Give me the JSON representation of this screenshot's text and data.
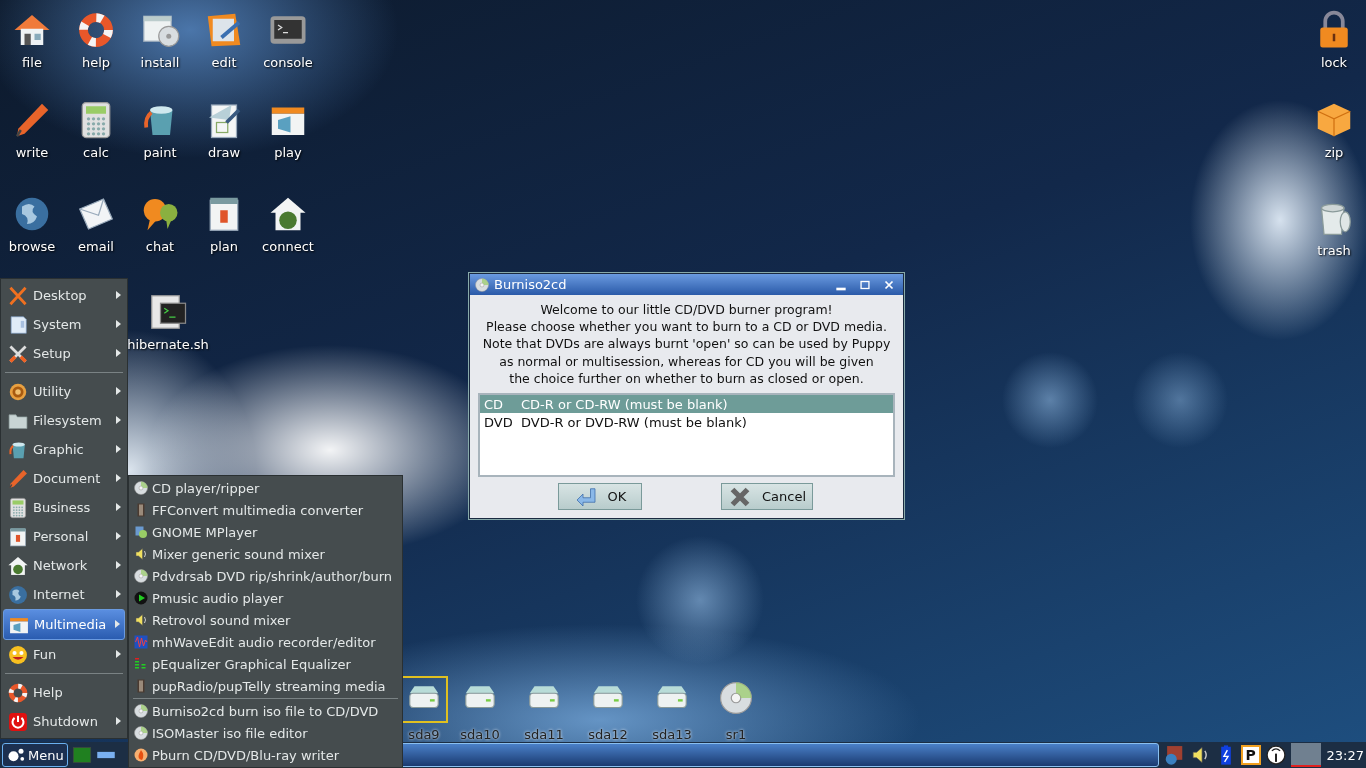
{
  "desktop_icons": [
    {
      "label": "file",
      "kind": "house"
    },
    {
      "label": "help",
      "kind": "lifebuoy"
    },
    {
      "label": "install",
      "kind": "window-disc"
    },
    {
      "label": "edit",
      "kind": "notepad"
    },
    {
      "label": "console",
      "kind": "terminal"
    },
    {
      "label": "write",
      "kind": "pen"
    },
    {
      "label": "calc",
      "kind": "calculator"
    },
    {
      "label": "paint",
      "kind": "paint-bucket"
    },
    {
      "label": "draw",
      "kind": "set-square"
    },
    {
      "label": "play",
      "kind": "clapper"
    },
    {
      "label": "browse",
      "kind": "globe"
    },
    {
      "label": "email",
      "kind": "envelope"
    },
    {
      "label": "chat",
      "kind": "speech-bubbles"
    },
    {
      "label": "plan",
      "kind": "calendar"
    },
    {
      "label": "connect",
      "kind": "globe-house"
    }
  ],
  "right_icons": [
    {
      "label": "lock",
      "kind": "padlock"
    },
    {
      "label": "zip",
      "kind": "box"
    },
    {
      "label": "trash",
      "kind": "trash-can"
    }
  ],
  "file_icons": [
    {
      "label": "hibernate.sh",
      "kind": "script"
    }
  ],
  "drive_icons": [
    {
      "label": "sda9",
      "kind": "drive",
      "selected": true
    },
    {
      "label": "sda10",
      "kind": "drive",
      "selected": false
    },
    {
      "label": "sda11",
      "kind": "drive",
      "selected": false
    },
    {
      "label": "sda12",
      "kind": "drive",
      "selected": false
    },
    {
      "label": "sda13",
      "kind": "drive",
      "selected": false
    },
    {
      "label": "sr1",
      "kind": "disc",
      "selected": false
    }
  ],
  "main_menu": {
    "sections": [
      {
        "items": [
          {
            "label": "Desktop",
            "kind": "x-logo",
            "has_submenu": true,
            "selected": false
          },
          {
            "label": "System",
            "kind": "computer",
            "has_submenu": true,
            "selected": false
          },
          {
            "label": "Setup",
            "kind": "tools",
            "has_submenu": true,
            "selected": false
          }
        ]
      },
      {
        "items": [
          {
            "label": "Utility",
            "kind": "ring",
            "has_submenu": true,
            "selected": false
          },
          {
            "label": "Filesystem",
            "kind": "folder",
            "has_submenu": true,
            "selected": false
          },
          {
            "label": "Graphic",
            "kind": "paint-bucket",
            "has_submenu": true,
            "selected": false
          },
          {
            "label": "Document",
            "kind": "pen",
            "has_submenu": true,
            "selected": false
          },
          {
            "label": "Business",
            "kind": "calculator",
            "has_submenu": true,
            "selected": false
          },
          {
            "label": "Personal",
            "kind": "calendar",
            "has_submenu": true,
            "selected": false
          },
          {
            "label": "Network",
            "kind": "globe-house",
            "has_submenu": true,
            "selected": false
          },
          {
            "label": "Internet",
            "kind": "globe",
            "has_submenu": true,
            "selected": false
          },
          {
            "label": "Multimedia",
            "kind": "clapper",
            "has_submenu": true,
            "selected": true
          },
          {
            "label": "Fun",
            "kind": "smiley",
            "has_submenu": true,
            "selected": false
          }
        ]
      },
      {
        "items": [
          {
            "label": "Help",
            "kind": "lifebuoy",
            "has_submenu": false,
            "selected": false
          },
          {
            "label": "Shutdown",
            "kind": "power",
            "has_submenu": true,
            "selected": false
          }
        ]
      }
    ]
  },
  "submenu": {
    "sections": [
      {
        "items": [
          {
            "label": "CD player/ripper",
            "kind": "disc"
          },
          {
            "label": "FFConvert multimedia converter",
            "kind": "film"
          },
          {
            "label": "GNOME MPlayer",
            "kind": "video"
          },
          {
            "label": "Mixer generic sound mixer",
            "kind": "speaker"
          },
          {
            "label": "Pdvdrsab DVD rip/shrink/author/burn",
            "kind": "disc"
          },
          {
            "label": "Pmusic audio player",
            "kind": "play"
          },
          {
            "label": "Retrovol sound mixer",
            "kind": "speaker"
          },
          {
            "label": "mhWaveEdit audio recorder/editor",
            "kind": "waveform"
          },
          {
            "label": "pEqualizer Graphical Equalizer",
            "kind": "equalizer"
          },
          {
            "label": "pupRadio/pupTelly streaming media",
            "kind": "film"
          }
        ]
      },
      {
        "items": [
          {
            "label": "Burniso2cd burn iso file to CD/DVD",
            "kind": "disc"
          },
          {
            "label": "ISOMaster iso file editor",
            "kind": "disc"
          },
          {
            "label": "Pburn CD/DVD/Blu-ray writer",
            "kind": "flame"
          }
        ]
      }
    ]
  },
  "dialog": {
    "title": "Burniso2cd",
    "message": [
      "Welcome to our little CD/DVD burner program!",
      "Please choose whether you want to burn to a CD or DVD media.",
      "Note that DVDs are always burnt 'open' so can be used by Puppy",
      "as normal or multisession, whereas for CD you will be given",
      "the choice further on whether to burn as closed or open."
    ],
    "list": [
      {
        "code": "CD",
        "description": "CD-R or CD-RW (must be blank)",
        "selected": true
      },
      {
        "code": "DVD",
        "description": "DVD-R or DVD-RW (must be blank)",
        "selected": false
      }
    ],
    "buttons": [
      {
        "label": "OK",
        "kind": "ok"
      },
      {
        "label": "Cancel",
        "kind": "cancel"
      }
    ]
  },
  "taskbar": {
    "menu_button": "Menu",
    "launchers": [
      {
        "kind": "screen"
      },
      {
        "kind": "panel-bar"
      }
    ],
    "tray": [
      {
        "kind": "globe-wall"
      },
      {
        "kind": "speaker"
      },
      {
        "kind": "battery"
      },
      {
        "kind": "letter-box",
        "label": "P"
      },
      {
        "kind": "antenna"
      },
      {
        "kind": "graph"
      }
    ],
    "clock": "23:27"
  }
}
